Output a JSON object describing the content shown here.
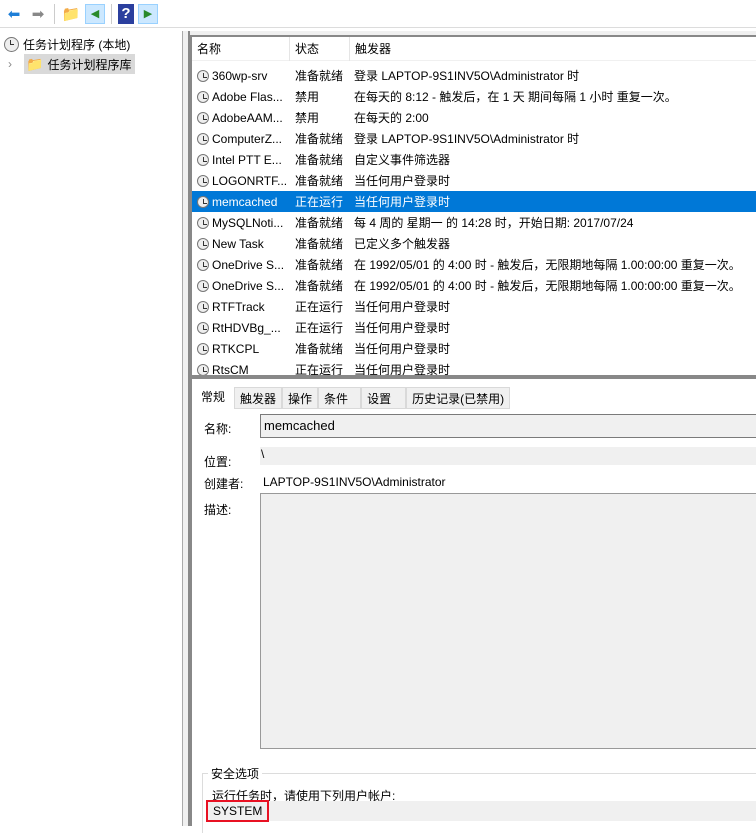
{
  "toolbar": {
    "icons": [
      "back-arrow-icon",
      "forward-arrow-icon",
      "up-folder-icon",
      "show-hide-console-tree-icon",
      "help-icon",
      "show-hide-action-pane-icon"
    ]
  },
  "tree": {
    "root": "任务计划程序 (本地)",
    "library": "任务计划程序库"
  },
  "list": {
    "headers": [
      "名称",
      "状态",
      "触发器"
    ],
    "rows": [
      {
        "name": "360wp-srv",
        "status": "准备就绪",
        "trigger": "登录 LAPTOP-9S1INV5O\\Administrator 时"
      },
      {
        "name": "Adobe Flas...",
        "status": "禁用",
        "trigger": "在每天的 8:12 - 触发后，在 1 天 期间每隔 1 小时 重复一次。"
      },
      {
        "name": "AdobeAAM...",
        "status": "禁用",
        "trigger": "在每天的 2:00"
      },
      {
        "name": "ComputerZ...",
        "status": "准备就绪",
        "trigger": "登录 LAPTOP-9S1INV5O\\Administrator 时"
      },
      {
        "name": "Intel PTT E...",
        "status": "准备就绪",
        "trigger": "自定义事件筛选器"
      },
      {
        "name": "LOGONRTF...",
        "status": "准备就绪",
        "trigger": "当任何用户登录时"
      },
      {
        "name": "memcached",
        "status": "正在运行",
        "trigger": "当任何用户登录时",
        "selected": true
      },
      {
        "name": "MySQLNoti...",
        "status": "准备就绪",
        "trigger": "每 4 周的 星期一 的 14:28 时，开始日期: 2017/07/24"
      },
      {
        "name": "New Task",
        "status": "准备就绪",
        "trigger": "已定义多个触发器"
      },
      {
        "name": "OneDrive S...",
        "status": "准备就绪",
        "trigger": "在 1992/05/01 的 4:00 时 - 触发后，无限期地每隔 1.00:00:00 重复一次。"
      },
      {
        "name": "OneDrive S...",
        "status": "准备就绪",
        "trigger": "在 1992/05/01 的 4:00 时 - 触发后，无限期地每隔 1.00:00:00 重复一次。"
      },
      {
        "name": "RTFTrack",
        "status": "正在运行",
        "trigger": "当任何用户登录时"
      },
      {
        "name": "RtHDVBg_...",
        "status": "正在运行",
        "trigger": "当任何用户登录时"
      },
      {
        "name": "RTKCPL",
        "status": "准备就绪",
        "trigger": "当任何用户登录时"
      },
      {
        "name": "RtsCM",
        "status": "正在运行",
        "trigger": "当任何用户登录时"
      }
    ]
  },
  "details": {
    "tabs": [
      "常规",
      "触发器",
      "操作",
      "条件",
      "设置",
      "历史记录(已禁用)"
    ],
    "name_label": "名称:",
    "name_value": "memcached",
    "location_label": "位置:",
    "location_value": "\\",
    "author_label": "创建者:",
    "author_value": "LAPTOP-9S1INV5O\\Administrator",
    "desc_label": "描述:",
    "security_title": "安全选项",
    "run_as_label": "运行任务时，请使用下列用户帐户:",
    "run_as_value": "SYSTEM"
  }
}
